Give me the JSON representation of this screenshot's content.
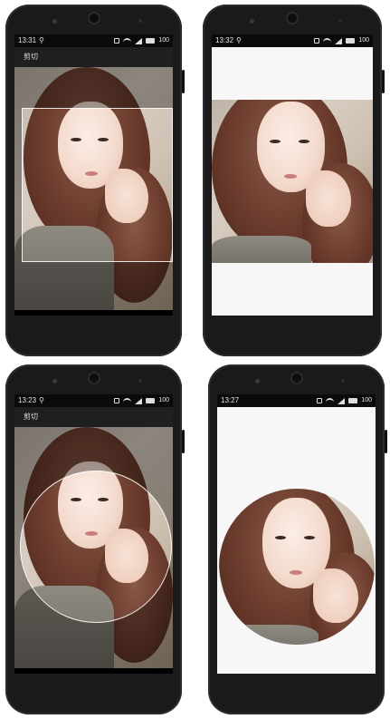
{
  "phones": [
    {
      "time": "13:31",
      "battery": "100",
      "title": "剪切",
      "mode": "rect-crop"
    },
    {
      "time": "13:32",
      "battery": "100",
      "title": "",
      "mode": "rect-result"
    },
    {
      "time": "13:23",
      "battery": "100",
      "title": "剪切",
      "mode": "circle-crop"
    },
    {
      "time": "13:27",
      "battery": "100",
      "title": "",
      "mode": "circle-result"
    }
  ],
  "icons": {
    "usb": "usb-icon",
    "vibrate": "vibrate-icon",
    "wifi": "wifi-icon",
    "signal": "signal-icon",
    "battery": "battery-icon"
  },
  "colors": {
    "phone_body": "#1a1a1c",
    "status_bar": "#0b0b0b",
    "app_bar": "#1f1f1f",
    "result_background": "#f7f7f7"
  }
}
